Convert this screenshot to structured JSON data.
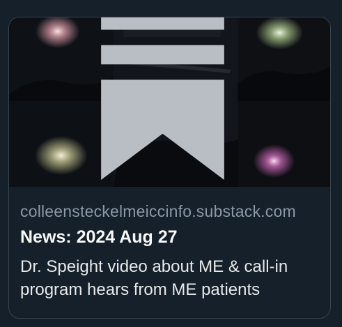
{
  "card": {
    "domain": "colleensteckelmeiccinfo.substack.com",
    "title": "News: 2024 Aug 27",
    "description": "Dr. Speight video about ME & call-in program hears from ME patients"
  },
  "media": {
    "overlay_icon": "bookmark-icon"
  },
  "colors": {
    "background": "#15202b",
    "border": "#38444d",
    "domain_text": "#8b98a5",
    "title_text": "#f7f9f9",
    "body_text": "#e7e9ea"
  }
}
